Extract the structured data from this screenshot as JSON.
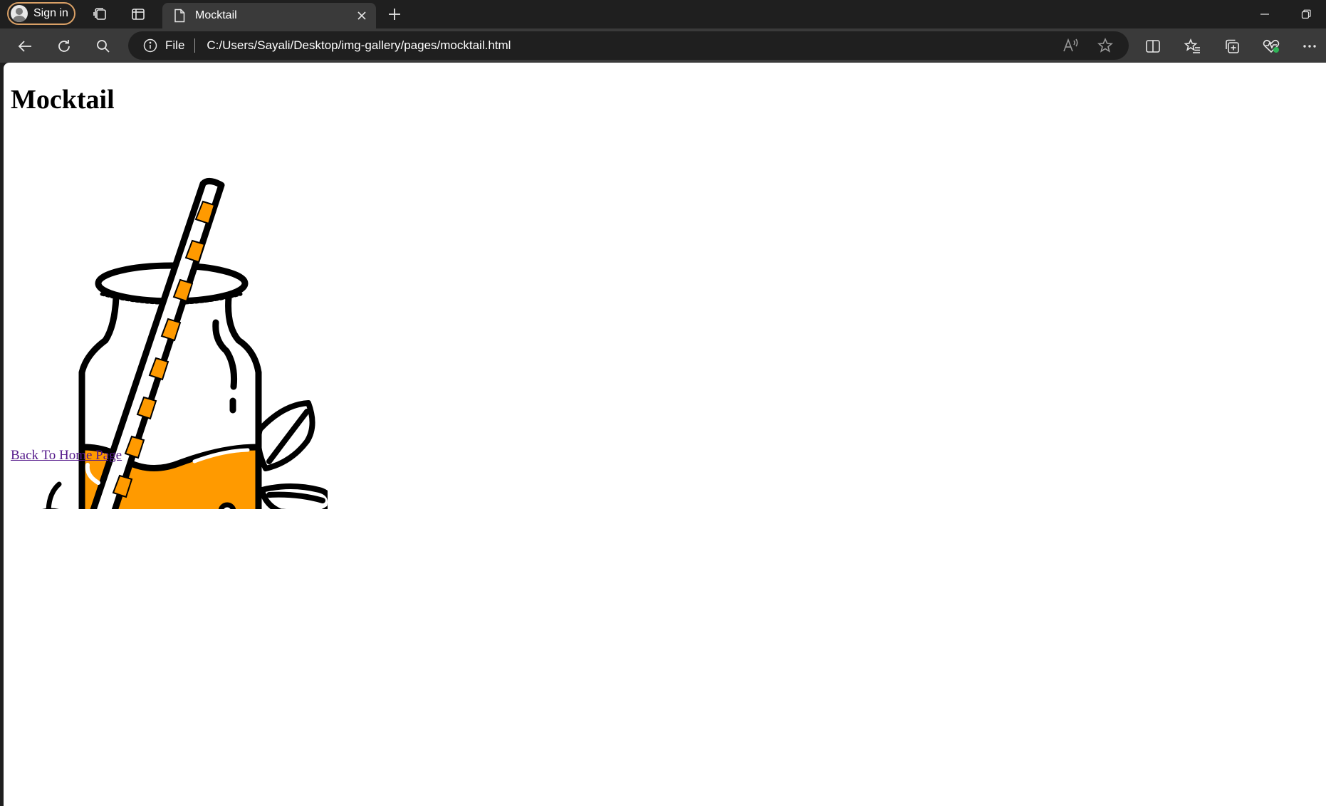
{
  "browser": {
    "profile_label": "Sign in",
    "tab_title": "Mocktail",
    "address_scheme": "File",
    "address_url": "C:/Users/Sayali/Desktop/img-gallery/pages/mocktail.html",
    "accent_color": "#d9a066"
  },
  "page": {
    "heading": "Mocktail",
    "image_alt": "Mocktail",
    "back_link": "Back To Home Page"
  },
  "illustration": {
    "juice_color": "#ff9a00",
    "outline_color": "#000000"
  }
}
